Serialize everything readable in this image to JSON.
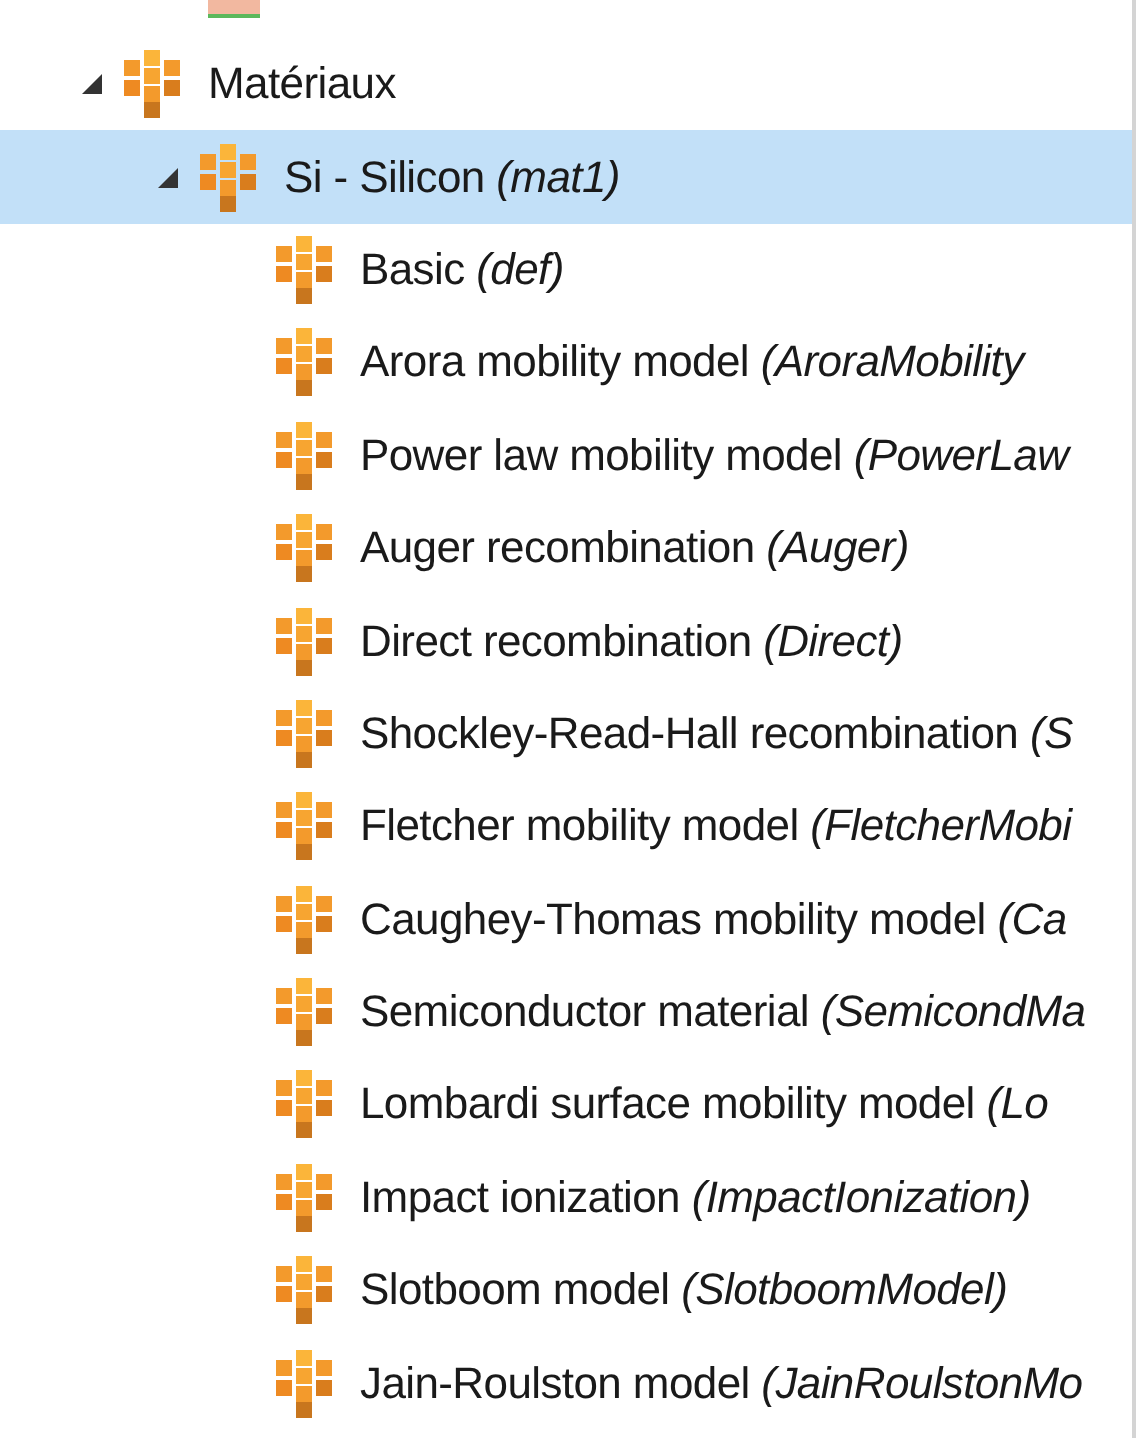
{
  "tree": [
    {
      "label": "Matériaux",
      "expanded": true,
      "selected": false,
      "children": [
        {
          "label": "Si - Silicon *(mat1)*",
          "expanded": true,
          "selected": true,
          "children": [
            {
              "label": "Basic *(def)*",
              "selected": false
            },
            {
              "label": "Arora mobility model *(AroraMobility*",
              "selected": false
            },
            {
              "label": "Power law mobility model *(PowerLaw*",
              "selected": false
            },
            {
              "label": "Auger recombination *(Auger)*",
              "selected": false
            },
            {
              "label": "Direct recombination *(Direct)*",
              "selected": false
            },
            {
              "label": "Shockley-Read-Hall recombination *(S*",
              "selected": false
            },
            {
              "label": "Fletcher mobility model *(FletcherMobi*",
              "selected": false
            },
            {
              "label": "Caughey-Thomas mobility model *(Ca*",
              "selected": false
            },
            {
              "label": "Semiconductor material *(SemicondMa*",
              "selected": false
            },
            {
              "label": "Lombardi surface mobility model *(Lo*",
              "selected": false
            },
            {
              "label": "Impact ionization *(ImpactIonization)*",
              "selected": false
            },
            {
              "label": "Slotboom model *(SlotboomModel)*",
              "selected": false
            },
            {
              "label": "Jain-Roulston model *(JainRoulstonMo*",
              "selected": false
            }
          ]
        }
      ]
    }
  ]
}
